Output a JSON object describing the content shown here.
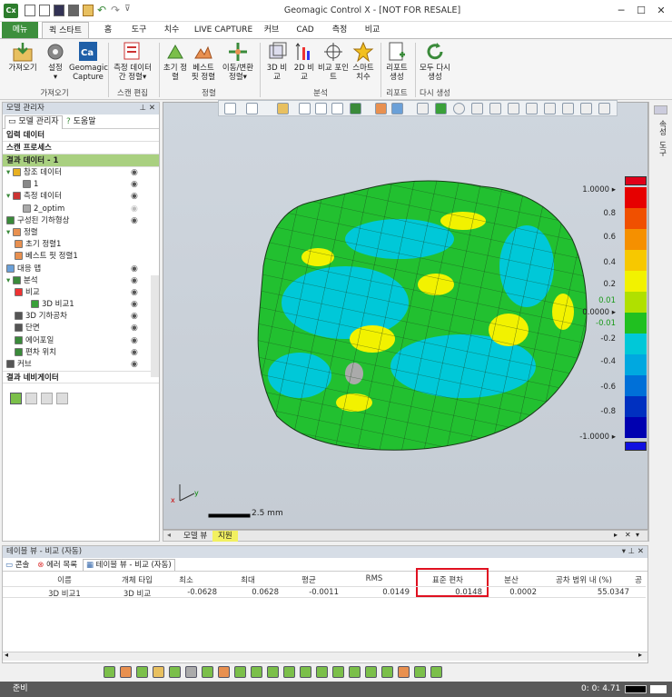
{
  "window": {
    "app_icon": "Cx",
    "title": "Geomagic Control X - [NOT FOR RESALE]",
    "controls": [
      "minimize-icon",
      "maximize-icon",
      "close-icon"
    ]
  },
  "ribbon_tabs": [
    "메뉴",
    "퀵 스타트",
    "홈",
    "도구",
    "치수",
    "LIVE CAPTURE",
    "커브",
    "CAD",
    "측정",
    "비교"
  ],
  "ribbon_groups": [
    {
      "label": "가져오기",
      "buttons": [
        "가져오기",
        "설정",
        "Geomagic Capture"
      ]
    },
    {
      "label": "스캔 편집",
      "buttons": [
        "측정 데이터 간 정렬"
      ]
    },
    {
      "label": "정렬",
      "buttons": [
        "초기 정렬",
        "베스트 핏 정렬",
        "이동/변환 정렬"
      ]
    },
    {
      "label": "분석",
      "buttons": [
        "3D 비교",
        "2D 비교",
        "비교 포인트",
        "스마트 치수"
      ]
    },
    {
      "label": "리포트",
      "buttons": [
        "리포트 생성"
      ]
    },
    {
      "label": "다시 생성",
      "buttons": [
        "모두 다시 생성"
      ]
    }
  ],
  "model_manager": {
    "title": "모델 관리자",
    "tabs": [
      "모델 관리자",
      "도움말"
    ],
    "sections": {
      "input": "입력 데이터",
      "scan": "스캔 프로세스",
      "result": "결과 데이터 - 1",
      "navigator": "결과 네비게이터"
    },
    "tree": [
      {
        "label": "참조 데이터",
        "indent": 0
      },
      {
        "label": "1",
        "indent": 2
      },
      {
        "label": "측정 데이터",
        "indent": 0
      },
      {
        "label": "2_optim",
        "indent": 2
      },
      {
        "label": "구성된 기하형상",
        "indent": 0
      },
      {
        "label": "정렬",
        "indent": 0
      },
      {
        "label": "초기 정렬1",
        "indent": 1
      },
      {
        "label": "베스트 핏 정렬1",
        "indent": 1
      },
      {
        "label": "대응 맵",
        "indent": 0
      },
      {
        "label": "분석",
        "indent": 0
      },
      {
        "label": "비교",
        "indent": 1
      },
      {
        "label": "3D 비교1",
        "indent": 3
      },
      {
        "label": "3D 기하공차",
        "indent": 1
      },
      {
        "label": "단면",
        "indent": 1
      },
      {
        "label": "에어포일",
        "indent": 1
      },
      {
        "label": "편차 위치",
        "indent": 1
      },
      {
        "label": "커브",
        "indent": 0
      }
    ]
  },
  "viewport": {
    "scale_label": "2.5 mm",
    "color_scale": {
      "labels": [
        "1.0000",
        "0.8",
        "0.6",
        "0.4",
        "0.2",
        "0.01",
        "0.0000",
        "-0.01",
        "-0.2",
        "-0.4",
        "-0.6",
        "-0.8",
        "-1.0000"
      ],
      "colors": [
        "#e60000",
        "#f05000",
        "#f59000",
        "#f7c800",
        "#f2f200",
        "#b0e000",
        "#20c020",
        "#00c8d8",
        "#00a8e0",
        "#0070d8",
        "#0030c0",
        "#0000b0"
      ]
    },
    "tabs": [
      "모델 뷰",
      "지원"
    ]
  },
  "right_strip": [
    "속성",
    "도구"
  ],
  "table_view": {
    "title": "테이블 뷰 - 비교 (자동)",
    "tabs": [
      "콘솔",
      "에러 목록",
      "테이블 뷰 - 비교 (자동)"
    ],
    "columns": [
      "이름",
      "개체 타입",
      "최소",
      "최대",
      "평균",
      "RMS",
      "표준 편차",
      "분산",
      "공차 범위 내 (%)",
      "공"
    ],
    "rows": [
      [
        "3D 비교1",
        "3D 비교",
        "-0.0628",
        "0.0628",
        "-0.0011",
        "0.0149",
        "0.0148",
        "0.0002",
        "55.0347",
        ""
      ]
    ],
    "highlight_column": "표준 편차"
  },
  "status": {
    "left": "준비",
    "right": "0: 0: 4.71"
  }
}
